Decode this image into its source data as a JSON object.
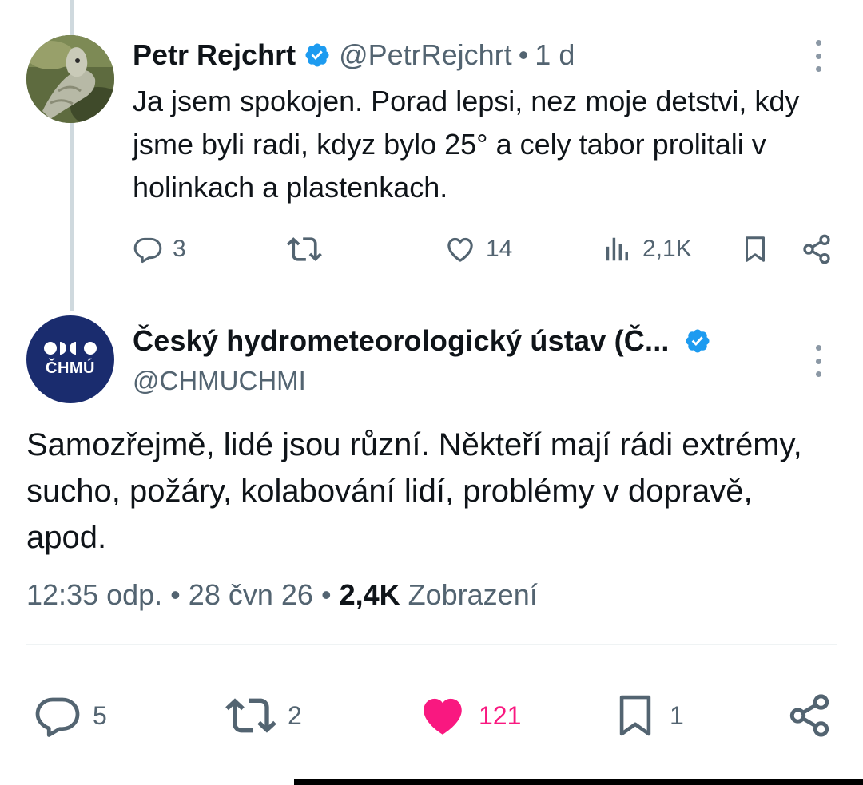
{
  "reply": {
    "author_name": "Petr Rejchrt",
    "handle": "@PetrRejchrt",
    "separator": "•",
    "time": "1 d",
    "text": "Ja jsem spokojen. Porad lepsi, nez moje detstvi, kdy jsme byli radi, kdyz bylo 25° a cely tabor prolitali v holinkach a plastenkach.",
    "counts": {
      "replies": "3",
      "likes": "14",
      "views": "2,1K"
    },
    "icons": [
      "reply-icon",
      "retweet-icon",
      "like-icon",
      "views-icon",
      "bookmark-icon",
      "share-icon",
      "more-icon",
      "verified-badge-icon"
    ]
  },
  "main": {
    "author_name": "Český hydrometeorologický ústav (Č...",
    "handle": "@CHMUCHMI",
    "avatar_text": "ČHMÚ",
    "text": "Samozřejmě, lidé jsou různí. Někteří mají rádi extrémy, sucho, požáry, kolabování lidí, problémy v dopravě, apod.",
    "meta": {
      "time": "12:35 odp.",
      "separator": "•",
      "date": "28 čvn 26",
      "views_count": "2,4K",
      "views_label": "Zobrazení"
    },
    "counts": {
      "replies": "5",
      "retweets": "2",
      "likes": "121",
      "bookmarks": "1"
    }
  },
  "colors": {
    "text": "#0f1419",
    "secondary": "#536471",
    "verified": "#1d9bf0",
    "like_active": "#f91880",
    "avatar_bg": "#1a2c6e",
    "thread_line": "#cfd9de"
  }
}
